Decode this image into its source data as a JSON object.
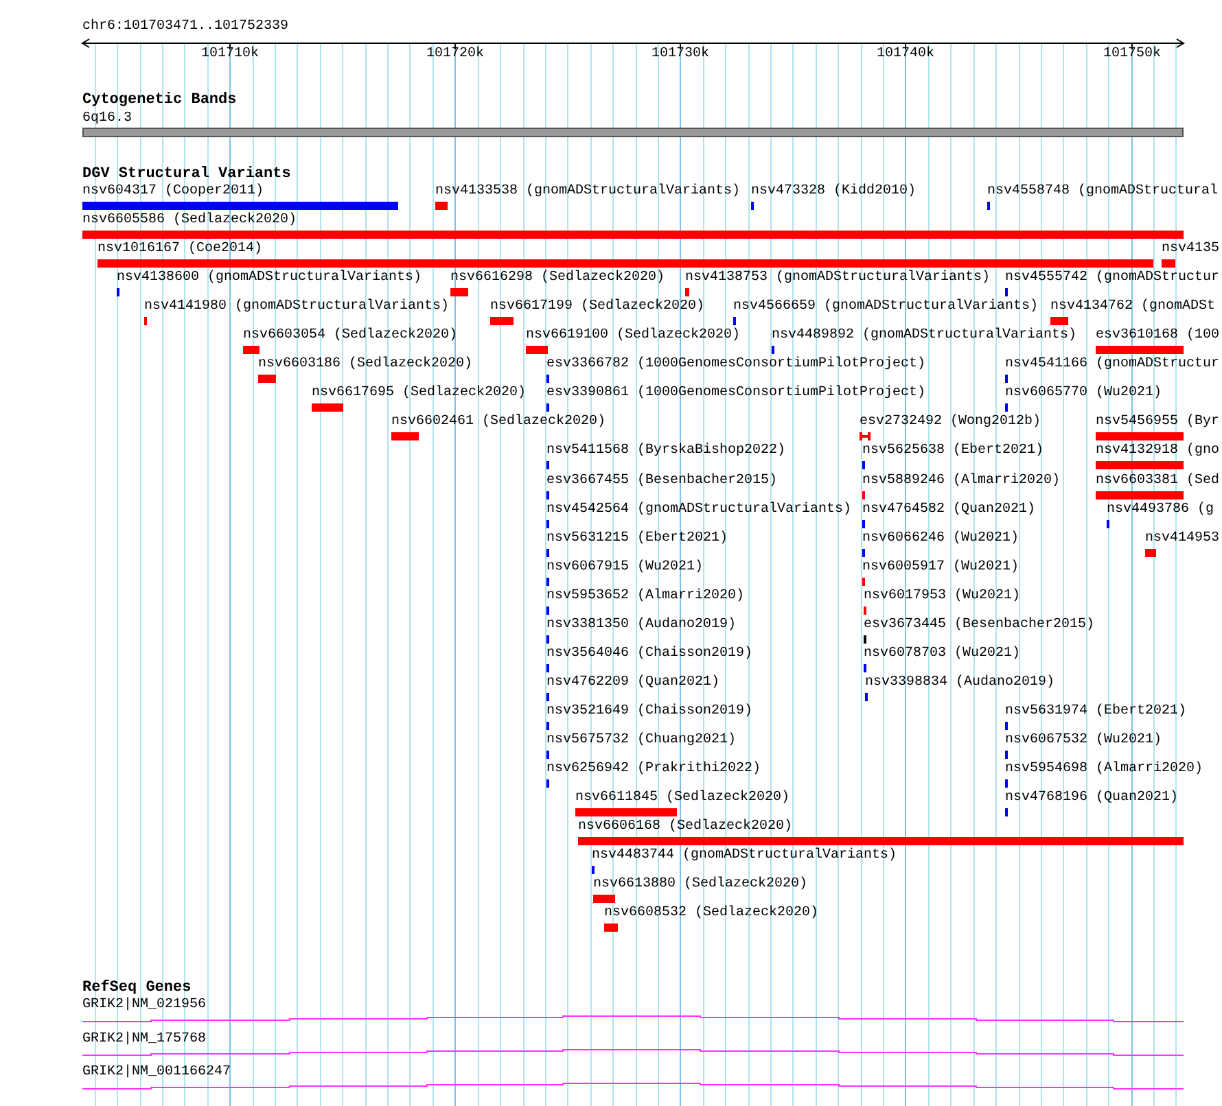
{
  "ruler": {
    "range": "chr6:101703471..101752339",
    "ticks": [
      "101710k",
      "101720k",
      "101730k",
      "101740k",
      "101750k"
    ]
  },
  "cytoband_track": {
    "title": "Cytogenetic Bands",
    "band": "6q16.3"
  },
  "dgv_track": {
    "title": "DGV Structural Variants",
    "rows": [
      [
        {
          "label": "nsv604317 (Cooper2011)",
          "color": "#0000ff",
          "kind": "bar"
        },
        {
          "label": "nsv4133538 (gnomADStructuralVariants)",
          "color": "#ff0000",
          "kind": "bar"
        },
        {
          "label": "nsv473328 (Kidd2010)",
          "color": "#0000ff",
          "kind": "bar"
        },
        {
          "label": "nsv4558748 (gnomADStructural",
          "color": "#0000ff",
          "kind": "bar"
        }
      ],
      [
        {
          "label": "nsv6605586 (Sedlazeck2020)",
          "color": "#ff0000",
          "kind": "bar"
        }
      ],
      [
        {
          "label": "nsv1016167 (Coe2014)",
          "color": "#ff0000",
          "kind": "bar"
        },
        {
          "label": "nsv4135",
          "color": "#ff0000",
          "kind": "bar"
        }
      ],
      [
        {
          "label": "nsv4138600 (gnomADStructuralVariants)",
          "color": "#0000ff",
          "kind": "bar"
        },
        {
          "label": "nsv6616298 (Sedlazeck2020)",
          "color": "#ff0000",
          "kind": "bar"
        },
        {
          "label": "nsv4138753 (gnomADStructuralVariants)",
          "color": "#ff0000",
          "kind": "bar"
        },
        {
          "label": "nsv4555742 (gnomADStructur",
          "color": "#0000ff",
          "kind": "bar"
        }
      ],
      [
        {
          "label": "nsv4141980 (gnomADStructuralVariants)",
          "color": "#ff0000",
          "kind": "bar"
        },
        {
          "label": "nsv6617199 (Sedlazeck2020)",
          "color": "#ff0000",
          "kind": "bar"
        },
        {
          "label": "nsv4566659 (gnomADStructuralVariants)",
          "color": "#0000ff",
          "kind": "bar"
        },
        {
          "label": "nsv4134762 (gnomADSt",
          "color": "#ff0000",
          "kind": "bar"
        }
      ],
      [
        {
          "label": "nsv6603054 (Sedlazeck2020)",
          "color": "#ff0000",
          "kind": "bar"
        },
        {
          "label": "nsv6619100 (Sedlazeck2020)",
          "color": "#ff0000",
          "kind": "bar"
        },
        {
          "label": "nsv4489892 (gnomADStructuralVariants)",
          "color": "#0000ff",
          "kind": "bar"
        },
        {
          "label": "esv3610168 (100",
          "color": "#ff0000",
          "kind": "bar"
        }
      ],
      [
        {
          "label": "nsv6603186 (Sedlazeck2020)",
          "color": "#ff0000",
          "kind": "bar"
        },
        {
          "label": "esv3366782 (1000GenomesConsortiumPilotProject)",
          "color": "#0000ff",
          "kind": "bar"
        },
        {
          "label": "nsv4541166 (gnomADStructur",
          "color": "#0000ff",
          "kind": "bar"
        }
      ],
      [
        {
          "label": "nsv6617695 (Sedlazeck2020)",
          "color": "#ff0000",
          "kind": "bar"
        },
        {
          "label": "esv3390861 (1000GenomesConsortiumPilotProject)",
          "color": "#0000ff",
          "kind": "bar"
        },
        {
          "label": "nsv6065770 (Wu2021)",
          "color": "#0000ff",
          "kind": "bar"
        }
      ],
      [
        {
          "label": "nsv6602461 (Sedlazeck2020)",
          "color": "#ff0000",
          "kind": "bar"
        },
        {
          "label": "esv2732492 (Wong2012b)",
          "color": "#ff0000",
          "kind": "interval"
        },
        {
          "label": "nsv5456955 (Byr",
          "color": "#ff0000",
          "kind": "bar"
        }
      ],
      [
        {
          "label": "nsv5411568 (ByrskaBishop2022)",
          "color": "#0000ff",
          "kind": "bar"
        },
        {
          "label": "nsv5625638 (Ebert2021)",
          "color": "#0000ff",
          "kind": "bar"
        },
        {
          "label": "nsv4132918 (gno",
          "color": "#ff0000",
          "kind": "bar"
        }
      ],
      [
        {
          "label": "esv3667455 (Besenbacher2015)",
          "color": "#0000ff",
          "kind": "bar"
        },
        {
          "label": "nsv5889246 (Almarri2020)",
          "color": "#ff0000",
          "kind": "bar"
        },
        {
          "label": "nsv6603381 (Sed",
          "color": "#ff0000",
          "kind": "bar"
        }
      ],
      [
        {
          "label": "nsv4542564 (gnomADStructuralVariants)",
          "color": "#0000ff",
          "kind": "bar"
        },
        {
          "label": "nsv4764582 (Quan2021)",
          "color": "#0000ff",
          "kind": "bar"
        },
        {
          "label": "nsv4493786 (g",
          "color": "#0000ff",
          "kind": "bar"
        }
      ],
      [
        {
          "label": "nsv5631215 (Ebert2021)",
          "color": "#0000ff",
          "kind": "bar"
        },
        {
          "label": "nsv6066246 (Wu2021)",
          "color": "#0000ff",
          "kind": "bar"
        },
        {
          "label": "nsv414953",
          "color": "#ff0000",
          "kind": "bar"
        }
      ],
      [
        {
          "label": "nsv6067915 (Wu2021)",
          "color": "#0000ff",
          "kind": "bar"
        },
        {
          "label": "nsv6005917 (Wu2021)",
          "color": "#ff0000",
          "kind": "bar"
        }
      ],
      [
        {
          "label": "nsv5953652 (Almarri2020)",
          "color": "#0000ff",
          "kind": "bar"
        },
        {
          "label": "nsv6017953 (Wu2021)",
          "color": "#ff0000",
          "kind": "bar"
        }
      ],
      [
        {
          "label": "nsv3381350 (Audano2019)",
          "color": "#0000ff",
          "kind": "bar"
        },
        {
          "label": "esv3673445 (Besenbacher2015)",
          "color": "#000000",
          "kind": "bar"
        }
      ],
      [
        {
          "label": "nsv3564046 (Chaisson2019)",
          "color": "#0000ff",
          "kind": "bar"
        },
        {
          "label": "nsv6078703 (Wu2021)",
          "color": "#0000ff",
          "kind": "bar"
        }
      ],
      [
        {
          "label": "nsv4762209 (Quan2021)",
          "color": "#0000ff",
          "kind": "bar"
        },
        {
          "label": "nsv3398834 (Audano2019)",
          "color": "#0000ff",
          "kind": "bar"
        }
      ],
      [
        {
          "label": "nsv3521649 (Chaisson2019)",
          "color": "#0000ff",
          "kind": "bar"
        },
        {
          "label": "nsv5631974 (Ebert2021)",
          "color": "#0000ff",
          "kind": "bar"
        }
      ],
      [
        {
          "label": "nsv5675732 (Chuang2021)",
          "color": "#0000ff",
          "kind": "bar"
        },
        {
          "label": "nsv6067532 (Wu2021)",
          "color": "#0000ff",
          "kind": "bar"
        }
      ],
      [
        {
          "label": "nsv6256942 (Prakrithi2022)",
          "color": "#0000ff",
          "kind": "bar"
        },
        {
          "label": "nsv5954698 (Almarri2020)",
          "color": "#0000ff",
          "kind": "bar"
        }
      ],
      [
        {
          "label": "nsv6611845 (Sedlazeck2020)",
          "color": "#ff0000",
          "kind": "bar"
        },
        {
          "label": "nsv4768196 (Quan2021)",
          "color": "#0000ff",
          "kind": "bar"
        }
      ],
      [
        {
          "label": "nsv6606168 (Sedlazeck2020)",
          "color": "#ff0000",
          "kind": "bar"
        }
      ],
      [
        {
          "label": "nsv4483744 (gnomADStructuralVariants)",
          "color": "#0000ff",
          "kind": "bar"
        }
      ],
      [
        {
          "label": "nsv6613880 (Sedlazeck2020)",
          "color": "#ff0000",
          "kind": "bar"
        }
      ],
      [
        {
          "label": "nsv6608532 (Sedlazeck2020)",
          "color": "#ff0000",
          "kind": "bar"
        }
      ]
    ]
  },
  "refseq_track": {
    "title": "RefSeq Genes",
    "transcripts": [
      {
        "label": "GRIK2|NM_021956"
      },
      {
        "label": "GRIK2|NM_175768"
      },
      {
        "label": "GRIK2|NM_001166247"
      }
    ]
  }
}
